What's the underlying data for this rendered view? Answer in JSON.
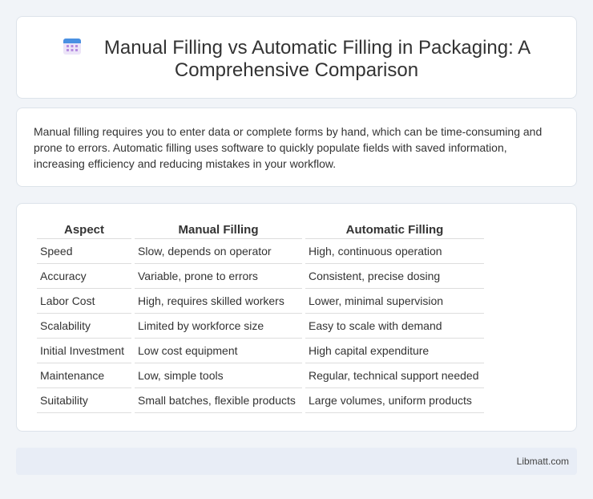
{
  "header": {
    "icon": "calendar-icon",
    "title": "Manual Filling vs Automatic Filling in Packaging: A Comprehensive Comparison"
  },
  "intro": {
    "text": "Manual filling requires you to enter data or complete forms by hand, which can be time-consuming and prone to errors. Automatic filling uses software to quickly populate fields with saved information, increasing efficiency and reducing mistakes in your workflow."
  },
  "table": {
    "headers": [
      "Aspect",
      "Manual Filling",
      "Automatic Filling"
    ],
    "rows": [
      [
        "Speed",
        "Slow, depends on operator",
        "High, continuous operation"
      ],
      [
        "Accuracy",
        "Variable, prone to errors",
        "Consistent, precise dosing"
      ],
      [
        "Labor Cost",
        "High, requires skilled workers",
        "Lower, minimal supervision"
      ],
      [
        "Scalability",
        "Limited by workforce size",
        "Easy to scale with demand"
      ],
      [
        "Initial Investment",
        "Low cost equipment",
        "High capital expenditure"
      ],
      [
        "Maintenance",
        "Low, simple tools",
        "Regular, technical support needed"
      ],
      [
        "Suitability",
        "Small batches, flexible products",
        "Large volumes, uniform products"
      ]
    ]
  },
  "footer": {
    "brand": "Libmatt.com"
  },
  "colors": {
    "accent": "#4a90e2",
    "icon_grid": "#b58be0"
  }
}
